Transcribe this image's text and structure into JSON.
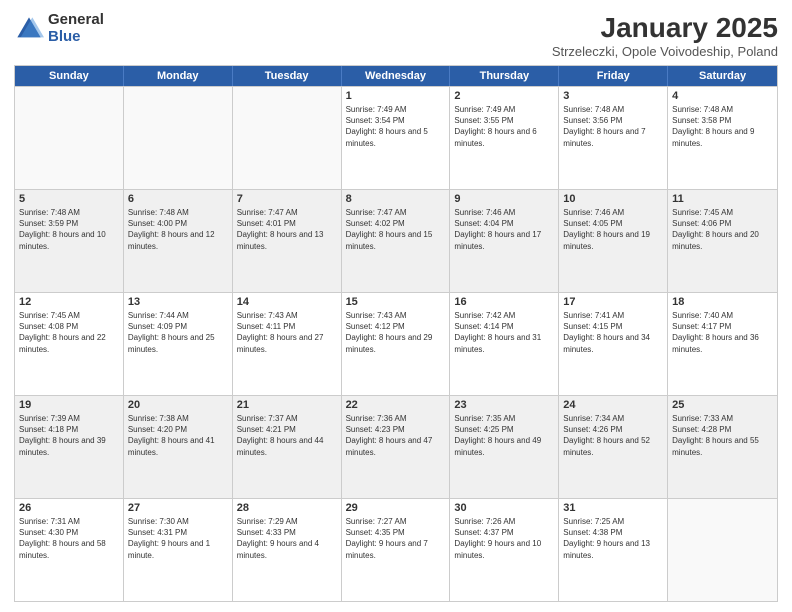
{
  "logo": {
    "general": "General",
    "blue": "Blue"
  },
  "title": {
    "month": "January 2025",
    "location": "Strzeleczki, Opole Voivodeship, Poland"
  },
  "header_days": [
    "Sunday",
    "Monday",
    "Tuesday",
    "Wednesday",
    "Thursday",
    "Friday",
    "Saturday"
  ],
  "weeks": [
    [
      {
        "day": "",
        "text": "",
        "empty": true
      },
      {
        "day": "",
        "text": "",
        "empty": true
      },
      {
        "day": "",
        "text": "",
        "empty": true
      },
      {
        "day": "1",
        "text": "Sunrise: 7:49 AM\nSunset: 3:54 PM\nDaylight: 8 hours and 5 minutes."
      },
      {
        "day": "2",
        "text": "Sunrise: 7:49 AM\nSunset: 3:55 PM\nDaylight: 8 hours and 6 minutes."
      },
      {
        "day": "3",
        "text": "Sunrise: 7:48 AM\nSunset: 3:56 PM\nDaylight: 8 hours and 7 minutes."
      },
      {
        "day": "4",
        "text": "Sunrise: 7:48 AM\nSunset: 3:58 PM\nDaylight: 8 hours and 9 minutes."
      }
    ],
    [
      {
        "day": "5",
        "text": "Sunrise: 7:48 AM\nSunset: 3:59 PM\nDaylight: 8 hours and 10 minutes.",
        "shaded": true
      },
      {
        "day": "6",
        "text": "Sunrise: 7:48 AM\nSunset: 4:00 PM\nDaylight: 8 hours and 12 minutes.",
        "shaded": true
      },
      {
        "day": "7",
        "text": "Sunrise: 7:47 AM\nSunset: 4:01 PM\nDaylight: 8 hours and 13 minutes.",
        "shaded": true
      },
      {
        "day": "8",
        "text": "Sunrise: 7:47 AM\nSunset: 4:02 PM\nDaylight: 8 hours and 15 minutes.",
        "shaded": true
      },
      {
        "day": "9",
        "text": "Sunrise: 7:46 AM\nSunset: 4:04 PM\nDaylight: 8 hours and 17 minutes.",
        "shaded": true
      },
      {
        "day": "10",
        "text": "Sunrise: 7:46 AM\nSunset: 4:05 PM\nDaylight: 8 hours and 19 minutes.",
        "shaded": true
      },
      {
        "day": "11",
        "text": "Sunrise: 7:45 AM\nSunset: 4:06 PM\nDaylight: 8 hours and 20 minutes.",
        "shaded": true
      }
    ],
    [
      {
        "day": "12",
        "text": "Sunrise: 7:45 AM\nSunset: 4:08 PM\nDaylight: 8 hours and 22 minutes."
      },
      {
        "day": "13",
        "text": "Sunrise: 7:44 AM\nSunset: 4:09 PM\nDaylight: 8 hours and 25 minutes."
      },
      {
        "day": "14",
        "text": "Sunrise: 7:43 AM\nSunset: 4:11 PM\nDaylight: 8 hours and 27 minutes."
      },
      {
        "day": "15",
        "text": "Sunrise: 7:43 AM\nSunset: 4:12 PM\nDaylight: 8 hours and 29 minutes."
      },
      {
        "day": "16",
        "text": "Sunrise: 7:42 AM\nSunset: 4:14 PM\nDaylight: 8 hours and 31 minutes."
      },
      {
        "day": "17",
        "text": "Sunrise: 7:41 AM\nSunset: 4:15 PM\nDaylight: 8 hours and 34 minutes."
      },
      {
        "day": "18",
        "text": "Sunrise: 7:40 AM\nSunset: 4:17 PM\nDaylight: 8 hours and 36 minutes."
      }
    ],
    [
      {
        "day": "19",
        "text": "Sunrise: 7:39 AM\nSunset: 4:18 PM\nDaylight: 8 hours and 39 minutes.",
        "shaded": true
      },
      {
        "day": "20",
        "text": "Sunrise: 7:38 AM\nSunset: 4:20 PM\nDaylight: 8 hours and 41 minutes.",
        "shaded": true
      },
      {
        "day": "21",
        "text": "Sunrise: 7:37 AM\nSunset: 4:21 PM\nDaylight: 8 hours and 44 minutes.",
        "shaded": true
      },
      {
        "day": "22",
        "text": "Sunrise: 7:36 AM\nSunset: 4:23 PM\nDaylight: 8 hours and 47 minutes.",
        "shaded": true
      },
      {
        "day": "23",
        "text": "Sunrise: 7:35 AM\nSunset: 4:25 PM\nDaylight: 8 hours and 49 minutes.",
        "shaded": true
      },
      {
        "day": "24",
        "text": "Sunrise: 7:34 AM\nSunset: 4:26 PM\nDaylight: 8 hours and 52 minutes.",
        "shaded": true
      },
      {
        "day": "25",
        "text": "Sunrise: 7:33 AM\nSunset: 4:28 PM\nDaylight: 8 hours and 55 minutes.",
        "shaded": true
      }
    ],
    [
      {
        "day": "26",
        "text": "Sunrise: 7:31 AM\nSunset: 4:30 PM\nDaylight: 8 hours and 58 minutes."
      },
      {
        "day": "27",
        "text": "Sunrise: 7:30 AM\nSunset: 4:31 PM\nDaylight: 9 hours and 1 minute."
      },
      {
        "day": "28",
        "text": "Sunrise: 7:29 AM\nSunset: 4:33 PM\nDaylight: 9 hours and 4 minutes."
      },
      {
        "day": "29",
        "text": "Sunrise: 7:27 AM\nSunset: 4:35 PM\nDaylight: 9 hours and 7 minutes."
      },
      {
        "day": "30",
        "text": "Sunrise: 7:26 AM\nSunset: 4:37 PM\nDaylight: 9 hours and 10 minutes."
      },
      {
        "day": "31",
        "text": "Sunrise: 7:25 AM\nSunset: 4:38 PM\nDaylight: 9 hours and 13 minutes."
      },
      {
        "day": "",
        "text": "",
        "empty": true
      }
    ]
  ]
}
